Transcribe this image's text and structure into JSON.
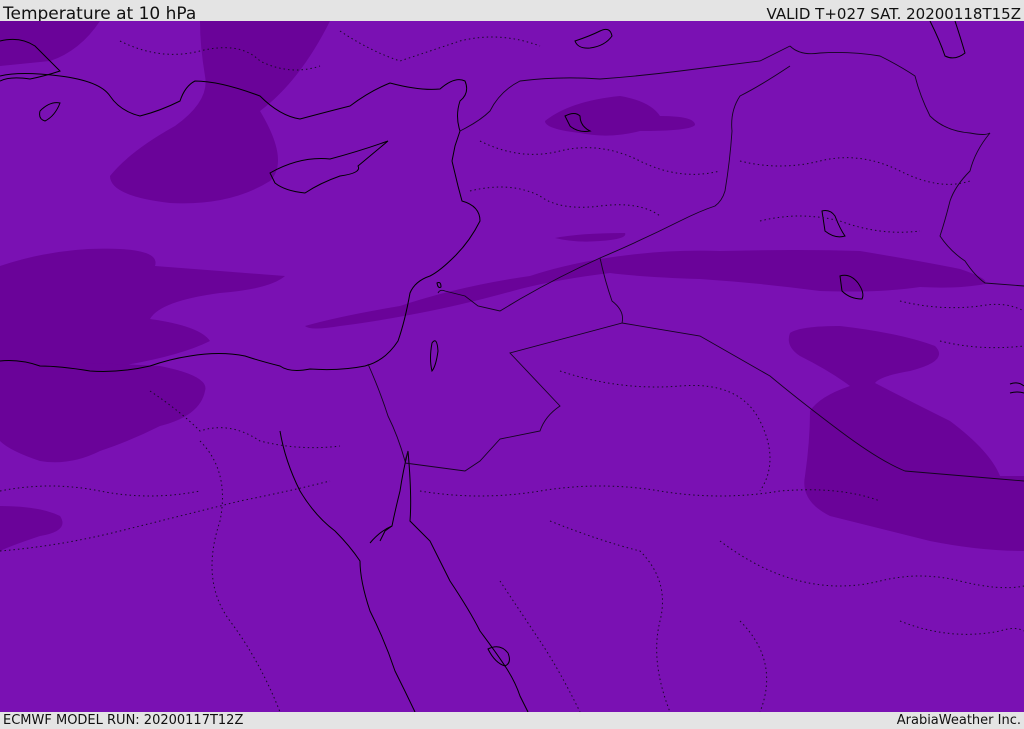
{
  "header": {
    "title": "Temperature at 10 hPa",
    "valid": "VALID T+027 SAT. 20200118T15Z"
  },
  "footer": {
    "model_run": "ECMWF MODEL RUN: 20200117T12Z",
    "credit": "ArabiaWeather Inc."
  },
  "map": {
    "fill_colors": {
      "base": "#7a11b3",
      "cold_band": "#6a0399",
      "coastline": "#000000",
      "border": "#1a0a2a"
    }
  }
}
